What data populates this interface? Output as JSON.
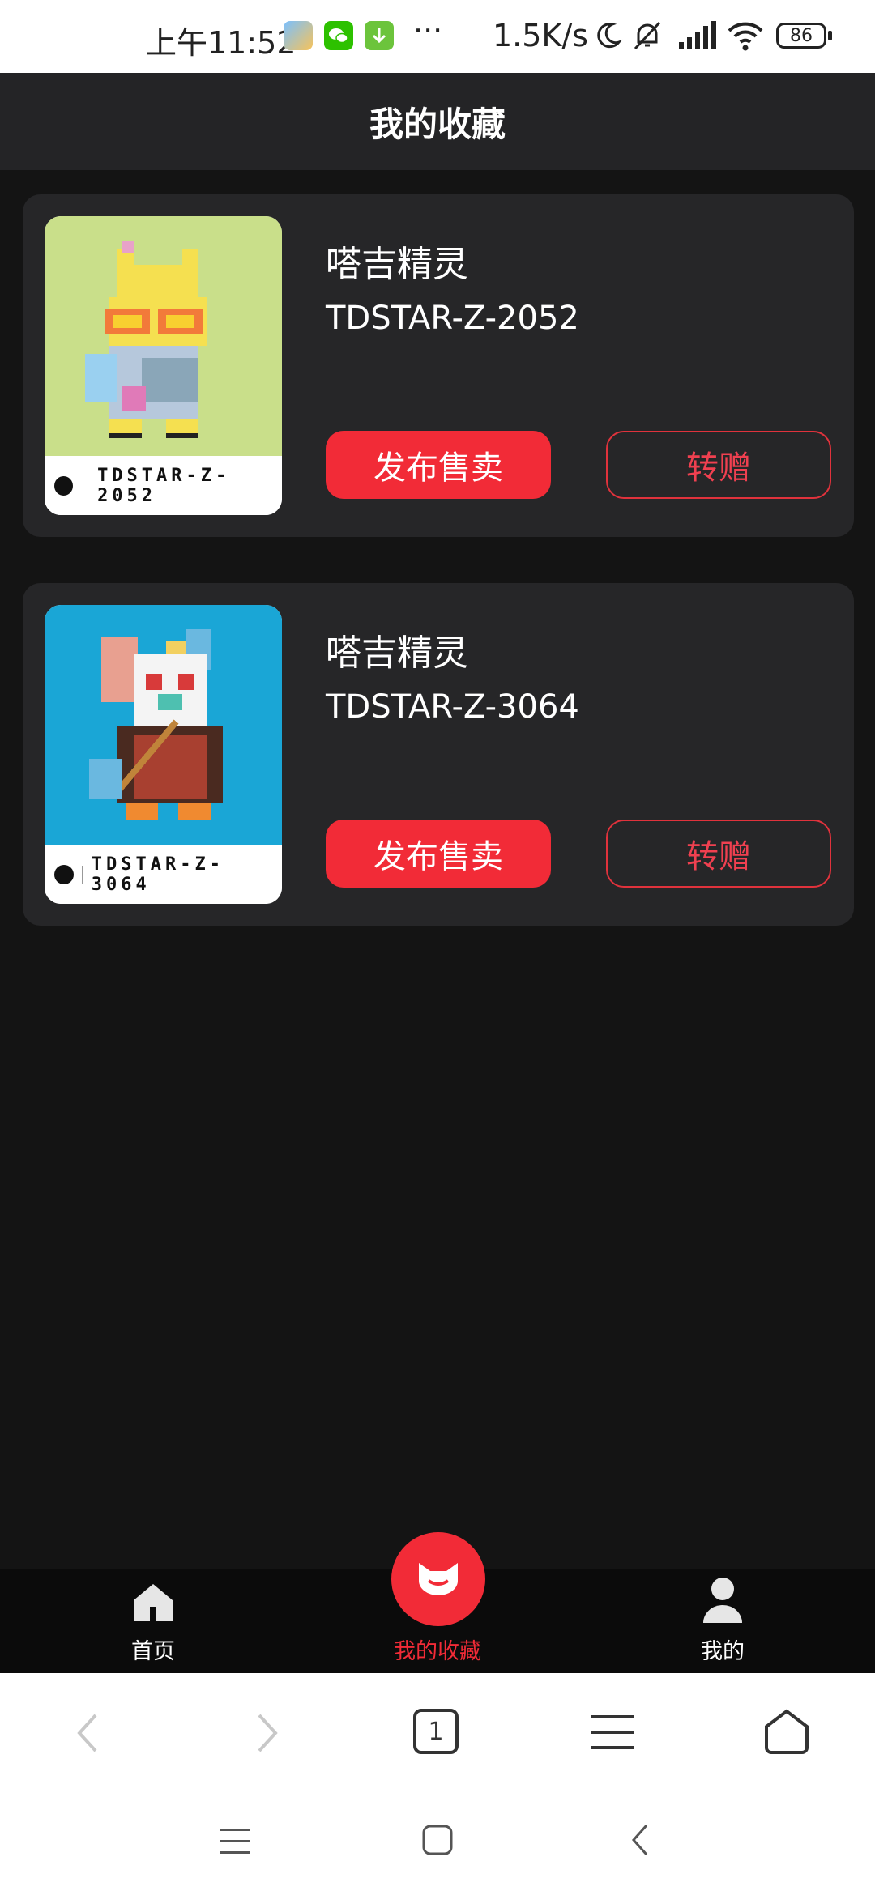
{
  "status_bar": {
    "time": "上午11:52",
    "more": "···",
    "net_speed": "1.5K/s",
    "battery": "86"
  },
  "header": {
    "title": "我的收藏"
  },
  "items": [
    {
      "title": "嗒吉精灵",
      "code": "TDSTAR-Z-2052",
      "badge": "TDSTAR-Z-2052",
      "sell_label": "发布售卖",
      "gift_label": "转赠",
      "bg": "#c9df8a"
    },
    {
      "title": "嗒吉精灵",
      "code": "TDSTAR-Z-3064",
      "badge": "TDSTAR-Z-3064",
      "sell_label": "发布售卖",
      "gift_label": "转赠",
      "bg": "#1aa6d6"
    }
  ],
  "tabbar": {
    "home": "首页",
    "collection": "我的收藏",
    "mine": "我的",
    "active_color": "#f22b37"
  },
  "browser": {
    "tab_count": "1"
  },
  "colors": {
    "accent": "#f22b37",
    "background": "#141414",
    "card": "#262628"
  }
}
